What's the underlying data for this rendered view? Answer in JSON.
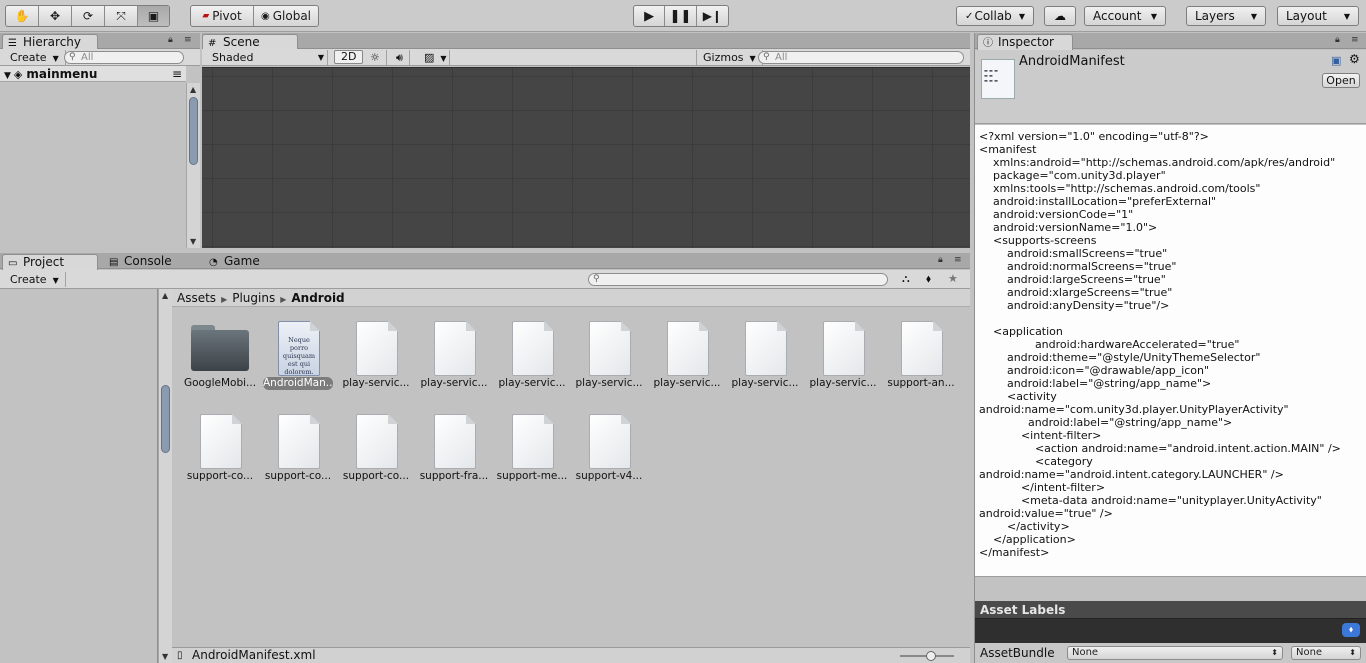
{
  "toolbar": {
    "tools": [
      "hand-icon",
      "move-icon",
      "rotate-icon",
      "scale-icon",
      "rect-icon"
    ],
    "pivot_label": "Pivot",
    "global_label": "Global",
    "collab_label": "Collab",
    "account_label": "Account",
    "layers_label": "Layers",
    "layout_label": "Layout"
  },
  "hierarchy": {
    "tab_label": "Hierarchy",
    "create_label": "Create",
    "search_placeholder": "All",
    "scene_name": "mainmenu"
  },
  "scene": {
    "tab_label": "Scene",
    "shading_mode": "Shaded",
    "mode_2d": "2D",
    "gizmos_label": "Gizmos",
    "search_placeholder": "All"
  },
  "project": {
    "tabs": {
      "project": "Project",
      "console": "Console",
      "game": "Game"
    },
    "create_label": "Create",
    "breadcrumb": [
      "Assets",
      "Plugins",
      "Android"
    ],
    "assets_row1": [
      {
        "label": "GoogleMobi..."
      },
      {
        "label": "AndroidMan..."
      },
      {
        "label": "play-servic..."
      },
      {
        "label": "play-servic..."
      },
      {
        "label": "play-servic..."
      },
      {
        "label": "play-servic..."
      },
      {
        "label": "play-servic..."
      },
      {
        "label": "play-servic..."
      },
      {
        "label": "play-servic..."
      },
      {
        "label": "support-an..."
      }
    ],
    "assets_row2": [
      {
        "label": "support-co..."
      },
      {
        "label": "support-co..."
      },
      {
        "label": "support-co..."
      },
      {
        "label": "support-fra..."
      },
      {
        "label": "support-me..."
      },
      {
        "label": "support-v4..."
      }
    ],
    "manifest_thumb_text": "Neque porro quisquam est qui dolorem.",
    "selected_path": "AndroidManifest.xml"
  },
  "inspector": {
    "tab_label": "Inspector",
    "asset_name": "AndroidManifest",
    "open_label": "Open",
    "xml_text": "<?xml version=\"1.0\" encoding=\"utf-8\"?>\n<manifest\n    xmlns:android=\"http://schemas.android.com/apk/res/android\"\n    package=\"com.unity3d.player\"\n    xmlns:tools=\"http://schemas.android.com/tools\"\n    android:installLocation=\"preferExternal\"\n    android:versionCode=\"1\"\n    android:versionName=\"1.0\">\n    <supports-screens\n        android:smallScreens=\"true\"\n        android:normalScreens=\"true\"\n        android:largeScreens=\"true\"\n        android:xlargeScreens=\"true\"\n        android:anyDensity=\"true\"/>\n\n    <application\n                android:hardwareAccelerated=\"true\"\n        android:theme=\"@style/UnityThemeSelector\"\n        android:icon=\"@drawable/app_icon\"\n        android:label=\"@string/app_name\">\n        <activity\nandroid:name=\"com.unity3d.player.UnityPlayerActivity\"\n              android:label=\"@string/app_name\">\n            <intent-filter>\n                <action android:name=\"android.intent.action.MAIN\" />\n                <category\nandroid:name=\"android.intent.category.LAUNCHER\" />\n            </intent-filter>\n            <meta-data android:name=\"unityplayer.UnityActivity\"\nandroid:value=\"true\" />\n        </activity>\n    </application>\n</manifest>",
    "asset_labels_title": "Asset Labels",
    "assetbundle_label": "AssetBundle",
    "bundle_value": "None",
    "variant_value": "None"
  }
}
